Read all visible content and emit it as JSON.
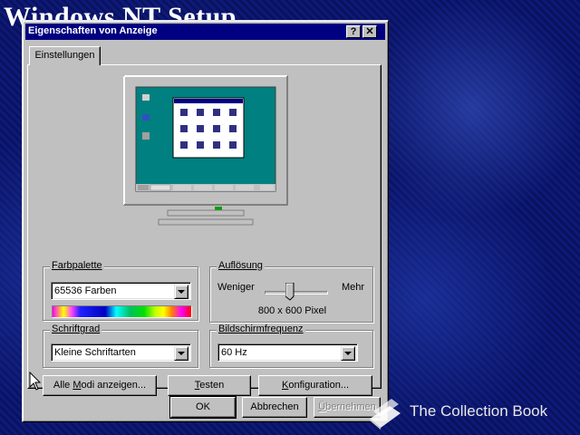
{
  "background": {
    "title": "Windows NT Setup",
    "watermark_text": "The Collection Book"
  },
  "dialog": {
    "title": "Eigenschaften von Anzeige",
    "help_button": "?",
    "close_button": "✕",
    "tab_label": "Einstellungen",
    "color_palette": {
      "label": "Farbpalette",
      "selected": "65536 Farben"
    },
    "resolution": {
      "label": "Auflösung",
      "less_label": "Weniger",
      "more_label": "Mehr",
      "value": "800 x 600 Pixel",
      "slider_level": 0.4
    },
    "font_size": {
      "label": "Schriftgrad",
      "selected": "Kleine Schriftarten"
    },
    "refresh_rate": {
      "label": "Bildschirmfrequenz",
      "selected": "60 Hz"
    },
    "buttons": {
      "list_modes_pre": "Alle ",
      "list_modes_u": "M",
      "list_modes_post": "odi anzeigen...",
      "test_u": "T",
      "test_post": "esten",
      "config_u": "K",
      "config_post": "onfiguration...",
      "ok": "OK",
      "cancel": "Abbrechen",
      "apply_u": "Ü",
      "apply_post": "bernehmen"
    }
  },
  "colors": {
    "desktop_teal": "#008080",
    "title_bar": "#000080",
    "face": "#c0c0c0"
  }
}
